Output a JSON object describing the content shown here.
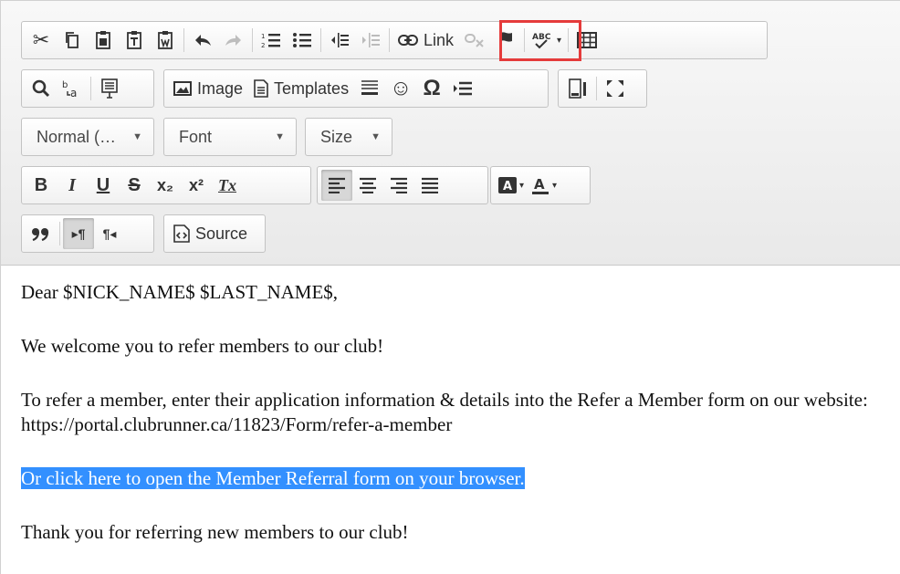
{
  "toolbar": {
    "link_label": "Link",
    "image_label": "Image",
    "templates_label": "Templates",
    "source_label": "Source",
    "format_combo": "Normal (…",
    "font_combo": "Font",
    "size_combo": "Size",
    "glyphs": {
      "cut": "✂",
      "undo": "↶",
      "redo": "↷",
      "bold": "B",
      "italic": "I",
      "underline": "U",
      "strike": "S",
      "subscript": "x₂",
      "superscript": "x²",
      "removeformat": "Tx",
      "smiley": "☺",
      "omega": "Ω",
      "quote": "❞",
      "ltr": "▸¶",
      "rtl": "¶◂",
      "spell": "ABC",
      "flag": "⚑"
    }
  },
  "highlight_color": "#e53b3b",
  "selection_color": "#3390ff",
  "content": {
    "greeting": "Dear $NICK_NAME$ $LAST_NAME$,",
    "welcome": "We welcome you to refer members to our club!",
    "instructions": "To refer a member, enter their application information & details into the Refer a Member form on our website:",
    "url": "https://portal.clubrunner.ca/11823/Form/refer-a-member",
    "selected_link": "Or click here to open the Member Referral form on your browser.",
    "thanks": "Thank you for referring new members to our club!"
  }
}
